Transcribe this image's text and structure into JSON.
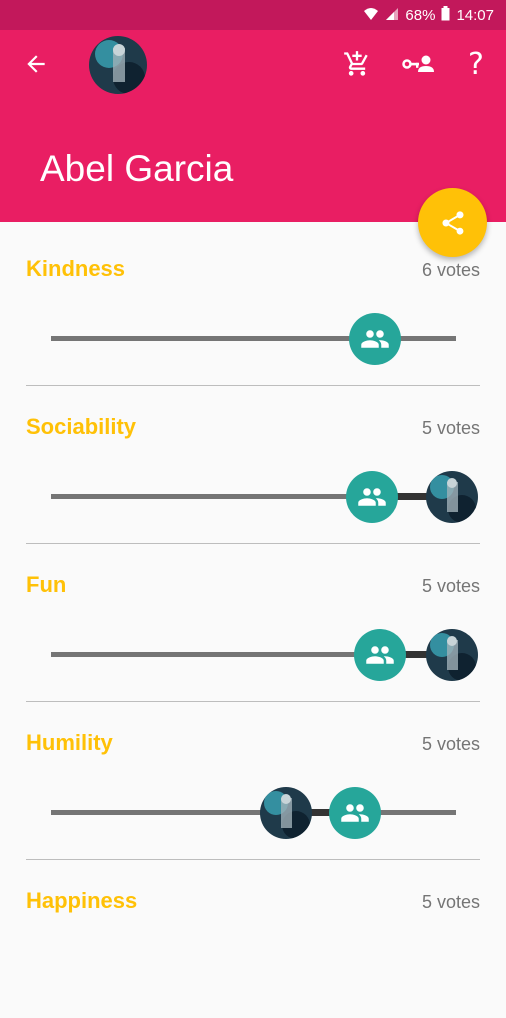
{
  "status_bar": {
    "battery": "68%",
    "time": "14:07"
  },
  "app_bar": {
    "icons": {
      "back": "arrow-left-icon",
      "cart": "add-shopping-cart-icon",
      "key_person": "person-key-icon",
      "help": "help-icon"
    },
    "help_label": "?"
  },
  "profile": {
    "name": "Abel Garcia"
  },
  "fab": {
    "icon": "share-icon"
  },
  "colors": {
    "primary": "#e91e63",
    "primary_dark": "#c2185b",
    "accent": "#ffc107",
    "teal": "#26a69a"
  },
  "traits": [
    {
      "name": "Kindness",
      "votes": "6 votes",
      "group_score": 0.8,
      "my_score": null
    },
    {
      "name": "Sociability",
      "votes": "5 votes",
      "group_score": 0.8,
      "my_score": 1.0
    },
    {
      "name": "Fun",
      "votes": "5 votes",
      "group_score": 0.82,
      "my_score": 1.0
    },
    {
      "name": "Humility",
      "votes": "5 votes",
      "group_score": 0.74,
      "my_score": 0.58
    },
    {
      "name": "Happiness",
      "votes": "5 votes",
      "group_score": null,
      "my_score": null
    }
  ]
}
